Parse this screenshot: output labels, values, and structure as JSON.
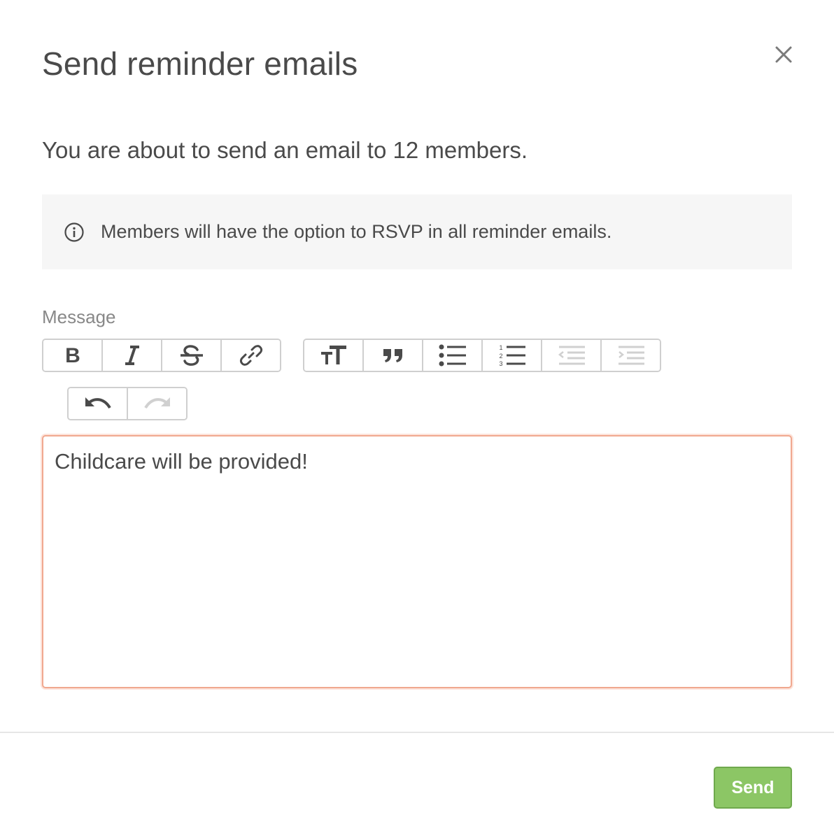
{
  "dialog": {
    "title": "Send reminder emails",
    "subtitle": "You are about to send an email to 12 members.",
    "notice": {
      "icon": "info-icon",
      "text": "Members will have the option to RSVP in all reminder emails."
    },
    "message": {
      "label": "Message",
      "value": "Childcare will be provided!"
    },
    "toolbar": {
      "groups": [
        [
          {
            "name": "bold",
            "icon": "bold-icon",
            "enabled": true
          },
          {
            "name": "italic",
            "icon": "italic-icon",
            "enabled": true
          },
          {
            "name": "strikethrough",
            "icon": "strikethrough-icon",
            "enabled": true
          },
          {
            "name": "link",
            "icon": "link-icon",
            "enabled": true
          }
        ],
        [
          {
            "name": "heading",
            "icon": "heading-icon",
            "enabled": true
          },
          {
            "name": "quote",
            "icon": "quote-icon",
            "enabled": true
          },
          {
            "name": "bullet-list",
            "icon": "bullet-list-icon",
            "enabled": true
          },
          {
            "name": "numbered-list",
            "icon": "numbered-list-icon",
            "enabled": true
          },
          {
            "name": "outdent",
            "icon": "outdent-icon",
            "enabled": false
          },
          {
            "name": "indent",
            "icon": "indent-icon",
            "enabled": false
          }
        ],
        [
          {
            "name": "undo",
            "icon": "undo-icon",
            "enabled": true
          },
          {
            "name": "redo",
            "icon": "redo-icon",
            "enabled": false
          }
        ]
      ]
    },
    "send_label": "Send",
    "close_icon": "close-icon"
  },
  "colors": {
    "text": "#4a4a4a",
    "muted": "#888888",
    "notice_bg": "#f6f6f6",
    "editor_focus_border": "#f0a88f",
    "send_bg": "#8cc665",
    "send_border": "#6fa94d",
    "disabled_icon": "#d0d0d0"
  }
}
